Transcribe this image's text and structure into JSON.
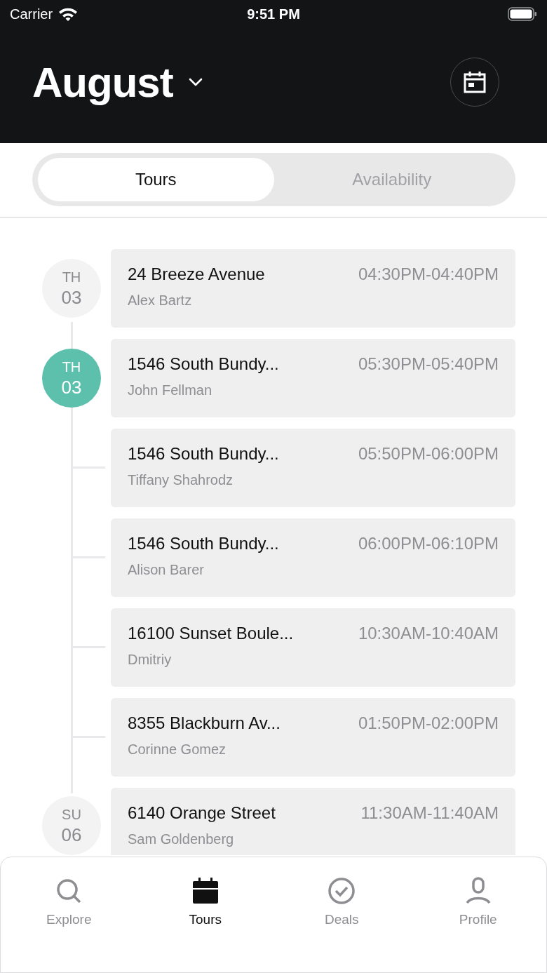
{
  "status_bar": {
    "carrier": "Carrier",
    "time": "9:51 PM"
  },
  "header": {
    "title": "August"
  },
  "segments": [
    {
      "label": "Tours",
      "selected": true
    },
    {
      "label": "Availability",
      "selected": false
    }
  ],
  "tours": [
    {
      "date": {
        "weekday": "TH",
        "day": "03",
        "selected": false
      },
      "address": "24 Breeze Avenue",
      "time": "04:30PM-04:40PM",
      "person": "Alex Bartz"
    },
    {
      "date": {
        "weekday": "TH",
        "day": "03",
        "selected": true
      },
      "address": "1546 South Bundy...",
      "time": "05:30PM-05:40PM",
      "person": "John Fellman"
    },
    {
      "address": "1546 South Bundy...",
      "time": "05:50PM-06:00PM",
      "person": "Tiffany Shahrodz"
    },
    {
      "address": "1546 South Bundy...",
      "time": "06:00PM-06:10PM",
      "person": "Alison Barer"
    },
    {
      "address": "16100 Sunset Boule...",
      "time": "10:30AM-10:40AM",
      "person": "Dmitriy"
    },
    {
      "address": "8355 Blackburn Av...",
      "time": "01:50PM-02:00PM",
      "person": "Corinne Gomez"
    },
    {
      "date": {
        "weekday": "SU",
        "day": "06",
        "selected": false
      },
      "address": "6140 Orange Street",
      "time": "11:30AM-11:40AM",
      "person": "Sam Goldenberg"
    }
  ],
  "tab_bar": [
    {
      "kind": "search",
      "label": "Explore",
      "selected": false
    },
    {
      "kind": "calendar",
      "label": "Tours",
      "selected": true
    },
    {
      "kind": "check",
      "label": "Deals",
      "selected": false
    },
    {
      "kind": "person",
      "label": "Profile",
      "selected": false
    }
  ]
}
